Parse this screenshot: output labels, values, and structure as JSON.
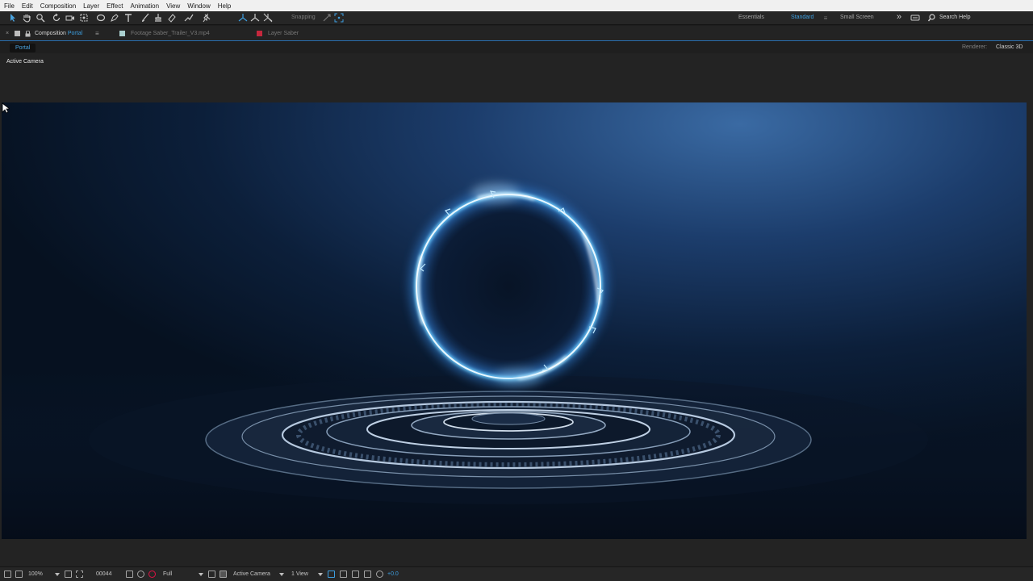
{
  "menu": [
    "File",
    "Edit",
    "Composition",
    "Layer",
    "Effect",
    "Animation",
    "View",
    "Window",
    "Help"
  ],
  "toolbar": {
    "snapping_label": "Snapping",
    "workspaces": [
      "Essentials",
      "Standard",
      "Small Screen"
    ],
    "active_workspace": "Standard",
    "search_help": "Search Help",
    "overflow_glyph": "»"
  },
  "tabs": {
    "comp_prefix": "Composition",
    "comp_name": "Portal",
    "footage": "Footage Saber_Trailer_V3.mp4",
    "layer": "Layer Saber",
    "menu_glyph": "≡",
    "close_glyph": "×"
  },
  "subheader": {
    "comp_chip": "Portal",
    "renderer_label": "Renderer:",
    "renderer_value": "Classic 3D"
  },
  "viewer": {
    "camera_label": "Active Camera"
  },
  "bottombar": {
    "zoom": "100%",
    "timecode": "00044",
    "resolution": "Full",
    "camera": "Active Camera",
    "views": "1 View",
    "exposure": "+0.0"
  },
  "colors": {
    "accent": "#3d9fe0",
    "portal_glow": "#6fd0ff",
    "background": "#07111f"
  }
}
